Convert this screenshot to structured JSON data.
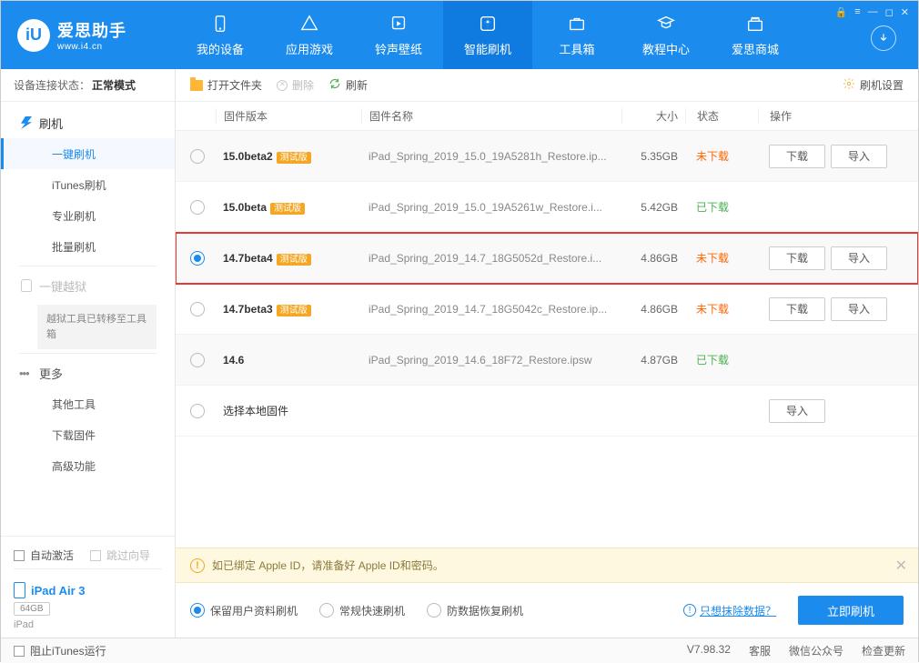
{
  "app": {
    "name": "爱思助手",
    "domain": "www.i4.cn"
  },
  "nav": {
    "items": [
      {
        "id": "device",
        "label": "我的设备"
      },
      {
        "id": "apps",
        "label": "应用游戏"
      },
      {
        "id": "ringtone",
        "label": "铃声壁纸"
      },
      {
        "id": "flash",
        "label": "智能刷机",
        "active": true
      },
      {
        "id": "toolbox",
        "label": "工具箱"
      },
      {
        "id": "tutorial",
        "label": "教程中心"
      },
      {
        "id": "store",
        "label": "爱思商城"
      }
    ]
  },
  "connection": {
    "label": "设备连接状态：",
    "value": "正常模式"
  },
  "sidebar": {
    "flash_head": "刷机",
    "items": [
      "一键刷机",
      "iTunes刷机",
      "专业刷机",
      "批量刷机"
    ],
    "jailbreak": "一键越狱",
    "note": "越狱工具已转移至工具箱",
    "more": "更多",
    "more_items": [
      "其他工具",
      "下载固件",
      "高级功能"
    ],
    "auto_activate": "自动激活",
    "skip_guide": "跳过向导",
    "device": {
      "name": "iPad Air 3",
      "capacity": "64GB",
      "type": "iPad"
    }
  },
  "toolbar": {
    "open_folder": "打开文件夹",
    "delete": "删除",
    "refresh": "刷新",
    "settings": "刷机设置"
  },
  "table": {
    "headers": {
      "version": "固件版本",
      "name": "固件名称",
      "size": "大小",
      "status": "状态",
      "op": "操作"
    },
    "rows": [
      {
        "version": "15.0beta2",
        "badge": "测试版",
        "name": "iPad_Spring_2019_15.0_19A5281h_Restore.ip...",
        "size": "5.35GB",
        "status": "未下载",
        "status_cls": "not",
        "selected": false,
        "ops": [
          "下载",
          "导入"
        ]
      },
      {
        "version": "15.0beta",
        "badge": "测试版",
        "name": "iPad_Spring_2019_15.0_19A5261w_Restore.i...",
        "size": "5.42GB",
        "status": "已下载",
        "status_cls": "done",
        "selected": false,
        "ops": []
      },
      {
        "version": "14.7beta4",
        "badge": "测试版",
        "name": "iPad_Spring_2019_14.7_18G5052d_Restore.i...",
        "size": "4.86GB",
        "status": "未下载",
        "status_cls": "not",
        "selected": true,
        "highlighted": true,
        "ops": [
          "下载",
          "导入"
        ]
      },
      {
        "version": "14.7beta3",
        "badge": "测试版",
        "name": "iPad_Spring_2019_14.7_18G5042c_Restore.ip...",
        "size": "4.86GB",
        "status": "未下载",
        "status_cls": "not",
        "selected": false,
        "ops": [
          "下载",
          "导入"
        ]
      },
      {
        "version": "14.6",
        "badge": "",
        "name": "iPad_Spring_2019_14.6_18F72_Restore.ipsw",
        "size": "4.87GB",
        "status": "已下载",
        "status_cls": "done",
        "selected": false,
        "ops": []
      },
      {
        "version": "",
        "badge": "",
        "name_as_version": "选择本地固件",
        "size": "",
        "status": "",
        "status_cls": "",
        "selected": false,
        "ops": [
          "导入"
        ]
      }
    ]
  },
  "alert": "如已绑定 Apple ID，请准备好 Apple ID和密码。",
  "modes": {
    "items": [
      "保留用户资料刷机",
      "常规快速刷机",
      "防数据恢复刷机"
    ],
    "selected": 0,
    "erase_link": "只想抹除数据？",
    "flash_now": "立即刷机"
  },
  "footer": {
    "block_itunes": "阻止iTunes运行",
    "version": "V7.98.32",
    "items": [
      "客服",
      "微信公众号",
      "检查更新"
    ]
  }
}
